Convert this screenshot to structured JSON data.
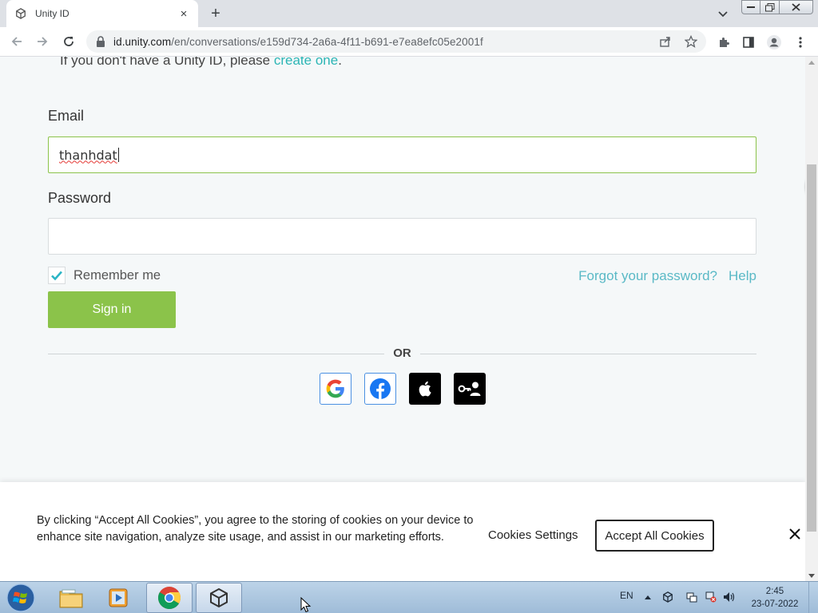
{
  "browser": {
    "tab": {
      "title": "Unity ID",
      "close": "×"
    },
    "new_tab": "+",
    "url_host": "id.unity.com",
    "url_path": "/en/conversations/e159d734-2a6a-4f11-b691-e7ea8efc05e2001f"
  },
  "page": {
    "intro_text": "If you don't have a Unity ID, please ",
    "intro_link": "create one",
    "intro_end": ".",
    "email_label": "Email",
    "email_value": "thanhdat",
    "password_label": "Password",
    "password_value": "",
    "remember_label": "Remember me",
    "remember_checked": true,
    "forgot_link": "Forgot your password?",
    "help_link": "Help",
    "signin_label": "Sign in",
    "or_label": "OR",
    "social_buttons": [
      "google-icon",
      "facebook-icon",
      "apple-icon",
      "key-user-icon"
    ]
  },
  "cookie_banner": {
    "text": "By clicking “Accept All Cookies”, you agree to the storing of cookies on your device to enhance site navigation, analyze site usage, and assist in our marketing efforts.",
    "settings_label": "Cookies Settings",
    "accept_label": "Accept All Cookies"
  },
  "taskbar": {
    "language": "EN",
    "time": "2:45",
    "date": "23-07-2022"
  },
  "colors": {
    "accent_green": "#8bc34a",
    "link_teal": "#2bb5b5"
  }
}
